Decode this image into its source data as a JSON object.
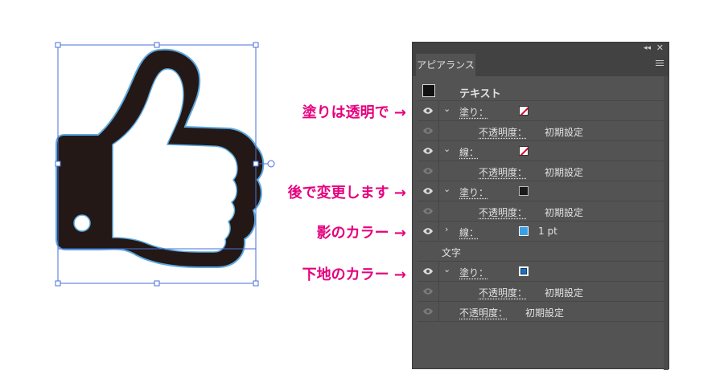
{
  "annotations": {
    "fill_transparent": "塗りは透明で →",
    "change_later": "後で変更します →",
    "shadow_color": "影のカラー →",
    "base_color": "下地のカラー →"
  },
  "panel": {
    "tab_label": "アピアランス",
    "collapse_icon": "double-chevron-icon",
    "close_icon": "close-icon",
    "menu_icon": "hamburger-icon",
    "object_label": "テキスト",
    "fill_label": "塗り：",
    "stroke_label": "線：",
    "opacity_label": "不透明度：",
    "opacity_value": "初期設定",
    "stroke_weight": "1 pt",
    "characters_label": "文字"
  },
  "colors": {
    "annotation": "#e6007e",
    "shadow_blue": "#3aa0e6",
    "base_blue": "#1f6fbf",
    "artwork_fill": "#231815",
    "artwork_outline": "#5aa7e0",
    "selection": "#4a6fd8"
  }
}
